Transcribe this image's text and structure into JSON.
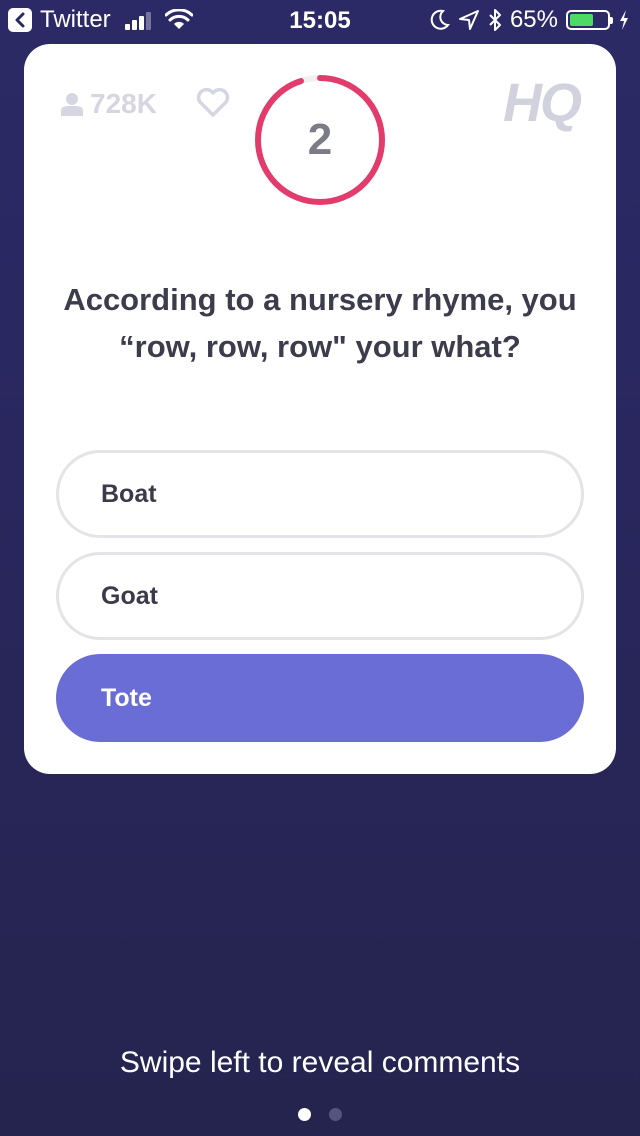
{
  "status_bar": {
    "back_app": "Twitter",
    "time": "15:05",
    "battery": "65%",
    "battery_level": 0.65,
    "icons": [
      "back-chevron-icon",
      "signal-icon",
      "wifi-icon",
      "moon-icon",
      "location-arrow-icon",
      "bluetooth-icon",
      "battery-icon",
      "charging-bolt-icon"
    ]
  },
  "game": {
    "viewers": "728K",
    "timer_value": "2",
    "timer_progress": 0.95,
    "logo": "HQ",
    "question": "According to a nursery rhyme, you “row, row, row\" your what?",
    "answers": [
      "Boat",
      "Goat",
      "Tote"
    ],
    "selected_answer": "Tote"
  },
  "colors": {
    "accent": "#e23c6d",
    "selected_answer": "#6a6dd5",
    "background": "#2c2a66",
    "battery_fill": "#4cd964"
  },
  "footer": {
    "hint": "Swipe left to reveal comments",
    "pages": 2,
    "current_page": 1
  }
}
